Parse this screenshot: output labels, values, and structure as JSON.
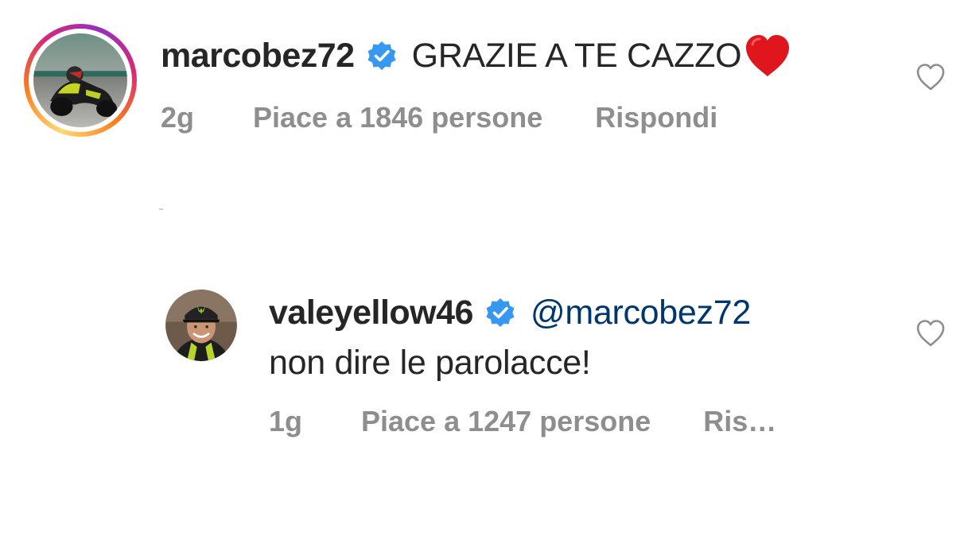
{
  "comments": [
    {
      "username": "marcobez72",
      "verified": true,
      "text": "GRAZIE A TE CAZZO",
      "emoji": "red-heart",
      "time": "2g",
      "likes": "Piace a 1846 persone",
      "reply": "Rispondi",
      "avatar_icon": "motorcycle-rider-photo",
      "avatar_ring": "story-gradient"
    },
    {
      "username": "valeyellow46",
      "verified": true,
      "mention": "@marcobez72",
      "text": "non dire le parolacce!",
      "time": "1g",
      "likes": "Piace a 1247 persone",
      "reply": "Ris…",
      "avatar_icon": "rider-portrait-photo"
    }
  ],
  "colors": {
    "verified_badge": "#3897f0",
    "mention": "#00376b",
    "meta_text": "#8e8e8e",
    "heart_emoji": "#e0161f"
  }
}
